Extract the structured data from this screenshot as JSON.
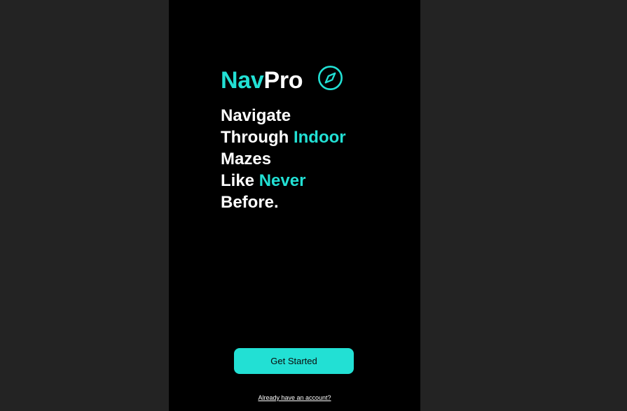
{
  "brand": {
    "name_part1": "Nav",
    "name_part2": "Pro",
    "icon": "compass-icon"
  },
  "tagline": {
    "line1": "Navigate",
    "line2_a": "Through ",
    "line2_b": "Indoor",
    "line3": "Mazes",
    "line4_a": "Like ",
    "line4_b": "Never",
    "line5": "Before."
  },
  "actions": {
    "get_started_label": "Get Started",
    "login_link_label": "Already have an account?"
  },
  "colors": {
    "accent": "#22e0d4",
    "screen_background": "#000000",
    "outer_background": "#232323",
    "text": "#ffffff"
  }
}
